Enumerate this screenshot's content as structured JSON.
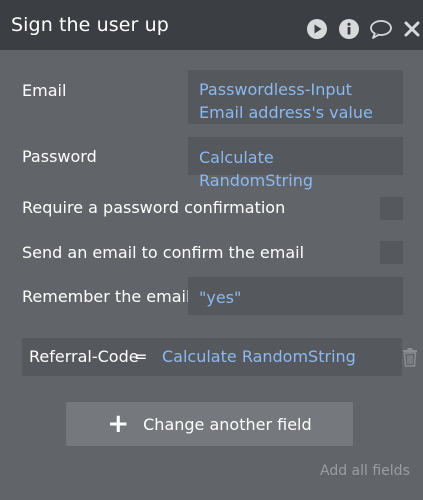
{
  "header": {
    "title": "Sign the user up",
    "icons": [
      "play-icon",
      "info-icon",
      "comment-icon",
      "close-icon"
    ]
  },
  "rows": {
    "email": {
      "label": "Email",
      "value": "Passwordless-Input Email address's value"
    },
    "password": {
      "label": "Password",
      "value": "Calculate RandomString"
    },
    "require_confirmation": {
      "label": "Require a password confirmation"
    },
    "send_email": {
      "label": "Send an email to confirm the email"
    },
    "remember_email": {
      "label": "Remember the email",
      "value": "\"yes\""
    }
  },
  "extra_field": {
    "key": "Referral-Code",
    "equals": "=",
    "value": "Calculate RandomString"
  },
  "actions": {
    "change_field": "Change another field",
    "add_all": "Add all fields"
  },
  "colors": {
    "panel_bg": "#616468",
    "header_bg": "#3b3e42",
    "field_bg": "#55585c",
    "expression_text": "#8cb9f0"
  }
}
